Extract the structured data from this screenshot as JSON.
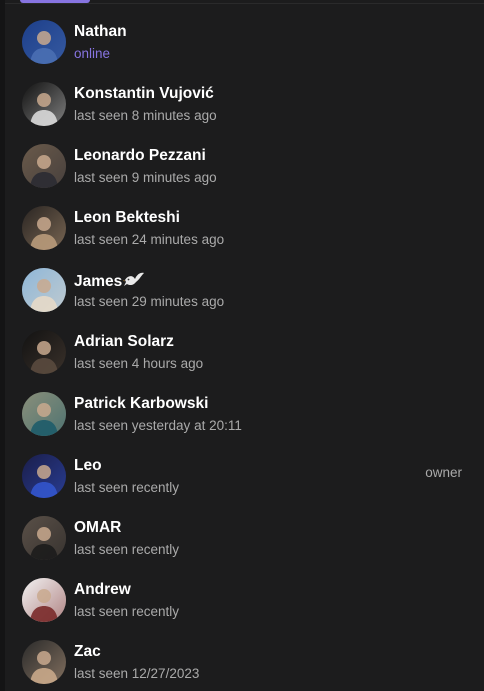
{
  "members": [
    {
      "name": "Nathan",
      "status": "online",
      "online": true,
      "role": "",
      "avatar_colors": [
        "#1d3f8a",
        "#4a6fb3"
      ]
    },
    {
      "name": "Konstantin Vujović",
      "status": "last seen 8 minutes ago",
      "online": false,
      "role": "",
      "avatar_colors": [
        "#111111",
        "#d9d9d9"
      ]
    },
    {
      "name": "Leonardo Pezzani",
      "status": "last seen 9 minutes ago",
      "online": false,
      "role": "",
      "avatar_colors": [
        "#6a5a4a",
        "#2b2b33"
      ]
    },
    {
      "name": "Leon Bekteshi",
      "status": "last seen 24 minutes ago",
      "online": false,
      "role": "",
      "avatar_colors": [
        "#2a2522",
        "#b89a7a"
      ]
    },
    {
      "name": "James",
      "status": "last seen 29 minutes ago",
      "online": false,
      "role": "",
      "emoji": "dove-icon",
      "avatar_colors": [
        "#8fb7d8",
        "#e6d9c8"
      ]
    },
    {
      "name": "Adrian Solarz",
      "status": "last seen 4 hours ago",
      "online": false,
      "role": "",
      "avatar_colors": [
        "#121212",
        "#5a4a3e"
      ]
    },
    {
      "name": "Patrick Karbowski",
      "status": "last seen yesterday at 20:11",
      "online": false,
      "role": "",
      "avatar_colors": [
        "#8a8f7a",
        "#1e5c6a"
      ]
    },
    {
      "name": "Leo",
      "status": "last seen recently",
      "online": false,
      "role": "owner",
      "avatar_colors": [
        "#1b1e4a",
        "#3355cc"
      ]
    },
    {
      "name": "OMAR",
      "status": "last seen recently",
      "online": false,
      "role": "",
      "avatar_colors": [
        "#5a5048",
        "#1c1c1c"
      ]
    },
    {
      "name": "Andrew",
      "status": "last seen recently",
      "online": false,
      "role": "",
      "avatar_colors": [
        "#f2f2f2",
        "#7a2a2a"
      ]
    },
    {
      "name": "Zac",
      "status": "last seen 12/27/2023",
      "online": false,
      "role": "",
      "avatar_colors": [
        "#2a2a2a",
        "#c9a88a"
      ]
    }
  ],
  "theme": {
    "accent": "#8774e1",
    "background": "#1c1c1d",
    "name_color": "#ffffff",
    "status_color": "#aaaaaa"
  }
}
